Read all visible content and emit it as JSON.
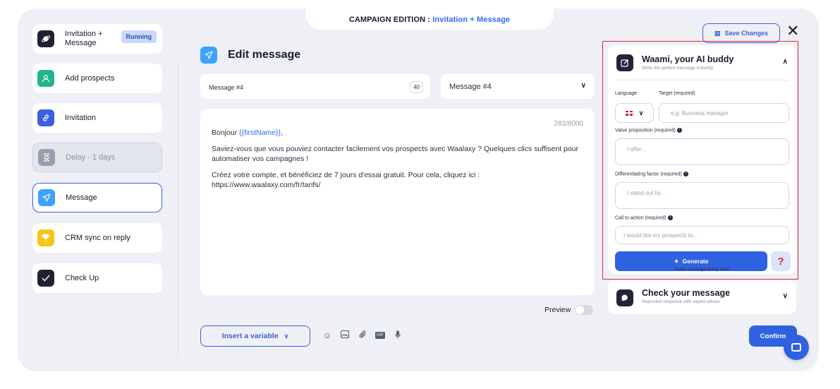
{
  "header": {
    "prefix": "CAMPAIGN EDITION :",
    "campaign_name": "Invitation + Message"
  },
  "sidebar": {
    "items": [
      {
        "label": "Invitation + Message",
        "icon": "planet-icon",
        "color": "#1f2235",
        "badge": "Running"
      },
      {
        "label": "Add prospects",
        "icon": "users-icon",
        "color": "#1fb58f"
      },
      {
        "label": "Invitation",
        "icon": "link-icon",
        "color": "#3b5fe0"
      },
      {
        "label": "Delay - 1 days",
        "icon": "hourglass-icon",
        "color": "#9a9eb0",
        "state": "disabled"
      },
      {
        "label": "Message",
        "icon": "send-icon",
        "color": "#3fa1ff",
        "state": "active"
      },
      {
        "label": "CRM sync on reply",
        "icon": "trophy-icon",
        "color": "#f5c518"
      },
      {
        "label": "Check Up",
        "icon": "check-icon",
        "color": "#1f2235"
      }
    ]
  },
  "editor": {
    "title": "Edit message",
    "message_name": "Message #4",
    "message_name_count": "40",
    "message_select": "Message #4",
    "char_counter": "283/8000",
    "greeting_prefix": "Bonjour ",
    "greeting_variable": "{{firstName}}",
    "greeting_suffix": ",",
    "paragraph_1": "Saviez-vous que vous pouviez contacter facilement vos prospects avec Waalaxy ? Quelques clics suffisent pour automatiser vos campagnes !",
    "paragraph_2": "Créez votre compte, et bénéficiez de 7 jours d'essai gratuit. Pour cela, cliquez ici : https://www.waalaxy.com/fr/tarifs/",
    "preview_label": "Preview",
    "preview_on": false,
    "insert_variable_label": "Insert a variable"
  },
  "ai_panel": {
    "save_label": "Save Changes",
    "title": "Waami, your AI buddy",
    "subtitle": "Write the perfect message instantly",
    "language_label": "Language",
    "target_label": "Target (required)",
    "target_placeholder": "e.g: Business manager",
    "value_label": "Value proposition (required)",
    "value_placeholder": "I offer...",
    "diff_label": "Differentiating factor (required)",
    "diff_placeholder": "I stand out by...",
    "cta_label": "Call to action (required)",
    "cta_placeholder": "I would like my prospects to...",
    "generate_label": "Generate",
    "help_label": "?",
    "fresh_note": "Fresh message every time!"
  },
  "check_panel": {
    "title": "Check your message",
    "subtitle": "Skyrocket response with expert advice"
  },
  "confirm_label": "Confirm",
  "colors": {
    "primary": "#2f62e0",
    "highlight_border": "#e0262a",
    "frame_bg": "#eef0f6"
  }
}
